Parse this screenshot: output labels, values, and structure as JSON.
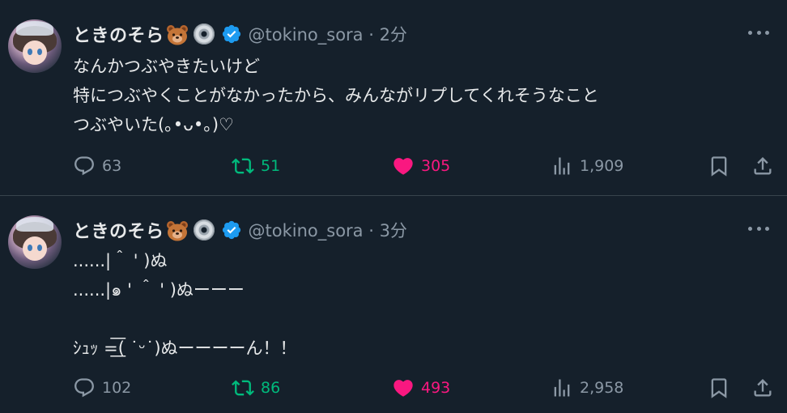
{
  "tweets": [
    {
      "name": "ときのそら",
      "handle": "@tokino_sora",
      "time": " · 2分",
      "lines": [
        "なんかつぶやきたいけど",
        "特につぶやくことがなかったから、みんながリプしてくれそうなこと",
        "つぶやいた(｡•ᴗ•｡)♡"
      ],
      "replies": "63",
      "retweets": "51",
      "likes": "305",
      "views": "1,909"
    },
    {
      "name": "ときのそら",
      "handle": "@tokino_sora",
      "time": " · 3分",
      "lines": [
        "......|＾ ' )ぬ",
        "......|๑ ' ＾ ' )ぬーーー",
        "",
        "ｼｭｯ =͟͟͞͞( ˙ᵕ˙)ぬーーーーん！！"
      ],
      "replies": "102",
      "retweets": "86",
      "likes": "493",
      "views": "2,958"
    }
  ],
  "colors": {
    "background": "#15202b",
    "text": "#e7e9ea",
    "muted": "#8b98a5",
    "retweet": "#00ba7c",
    "like": "#f91880",
    "verified": "#1d9bf0"
  },
  "icons": [
    "bear-emoji-icon",
    "cd-emoji-icon",
    "verified-badge-icon",
    "more-icon",
    "reply-icon",
    "retweet-icon",
    "like-icon",
    "views-icon",
    "bookmark-icon",
    "share-icon"
  ]
}
